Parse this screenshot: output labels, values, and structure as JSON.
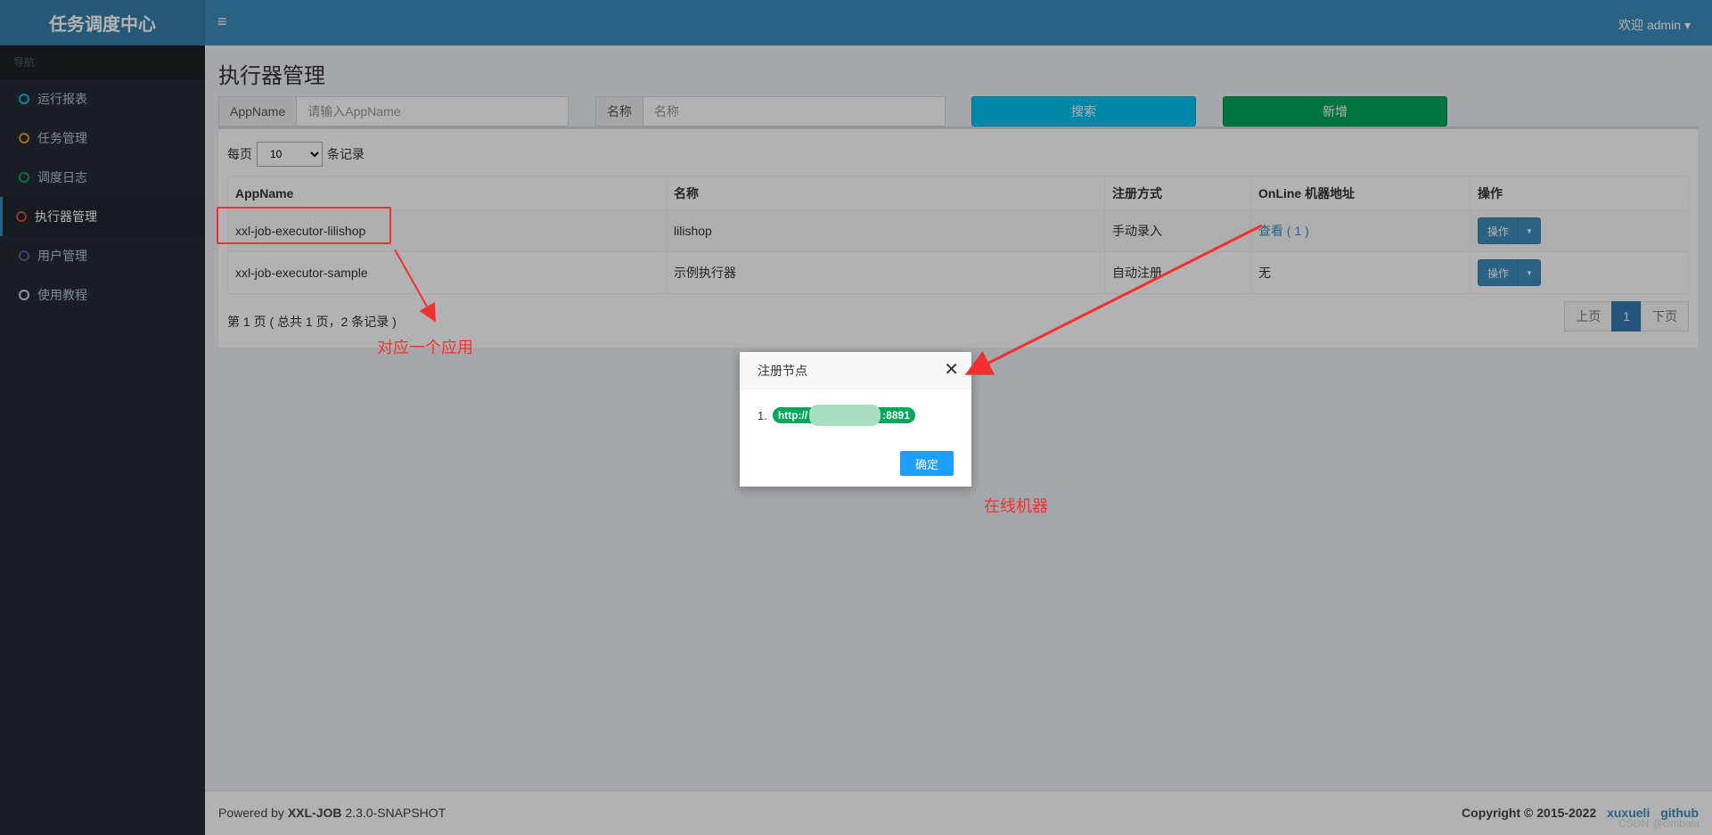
{
  "app": {
    "logo": "任务调度中心"
  },
  "sidebar": {
    "header": "导航",
    "items": [
      {
        "label": "运行报表",
        "color": "#00c0ef"
      },
      {
        "label": "任务管理",
        "color": "#f39c12"
      },
      {
        "label": "调度日志",
        "color": "#00a65a"
      },
      {
        "label": "执行器管理",
        "color": "#dd4b39"
      },
      {
        "label": "用户管理",
        "color": "#605ca8"
      },
      {
        "label": "使用教程",
        "color": "#d2d6de"
      }
    ]
  },
  "header": {
    "toggle": "≡",
    "user": "欢迎 admin ▾"
  },
  "page": {
    "title": "执行器管理"
  },
  "filters": {
    "appname_label": "AppName",
    "appname_placeholder": "请输入AppName",
    "title_label": "名称",
    "title_placeholder": "名称",
    "search_label": "搜索",
    "add_label": "新增"
  },
  "table": {
    "length_prefix": "每页",
    "length_value": "10",
    "length_suffix": "条记录",
    "columns": [
      "AppName",
      "名称",
      "注册方式",
      "OnLine 机器地址",
      "操作"
    ],
    "rows": [
      {
        "appname": "xxl-job-executor-lilishop",
        "title": "lilishop",
        "type": "手动录入",
        "online": "查看 ( 1 )",
        "action": "操作"
      },
      {
        "appname": "xxl-job-executor-sample",
        "title": "示例执行器",
        "type": "自动注册",
        "online": "无",
        "action": "操作"
      }
    ],
    "info": "第 1 页 ( 总共 1 页，2 条记录 )",
    "pager": {
      "prev": "上页",
      "current": "1",
      "next": "下页"
    }
  },
  "modal": {
    "title": "注册节点",
    "close": "✕",
    "item_index": "1.",
    "address_prefix": "http://",
    "address_suffix": ":8891",
    "ok": "确定"
  },
  "annotations": {
    "app_note": "对应一个应用",
    "machine_note": "在线机器"
  },
  "footer": {
    "powered_prefix": "Powered by ",
    "brand": "XXL-JOB",
    "version": " 2.3.0-SNAPSHOT",
    "copyright": "Copyright © 2015-2022",
    "link1": "xuxueli",
    "link2": "github"
  },
  "watermark": "CSDN @cimbala"
}
